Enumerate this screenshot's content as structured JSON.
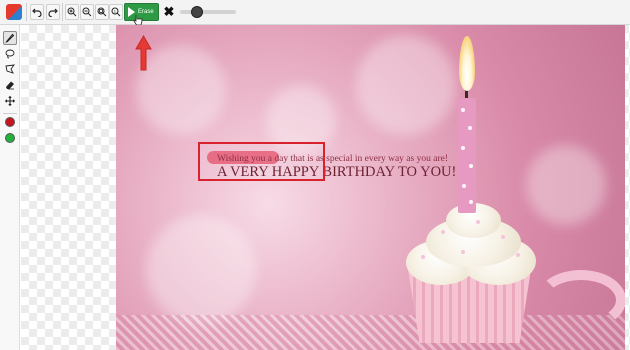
{
  "toolbar": {
    "undo_icon": "undo-icon",
    "redo_icon": "redo-icon",
    "zoom_in_icon": "zoom-in-icon",
    "zoom_out_icon": "zoom-out-icon",
    "zoom_fit_icon": "zoom-fit-icon",
    "zoom_reset_icon": "zoom-reset-icon",
    "erase_label": "Erase",
    "close_icon": "close-icon",
    "brush_size_level": 0.25
  },
  "tools": [
    {
      "name": "brush-tool",
      "icon": "pencil-icon",
      "active": true
    },
    {
      "name": "lasso-tool",
      "icon": "lasso-icon",
      "active": false
    },
    {
      "name": "polygon-lasso-tool",
      "icon": "polygon-lasso-icon",
      "active": false
    },
    {
      "name": "eraser-tool",
      "icon": "eraser-icon",
      "active": false
    },
    {
      "name": "move-tool",
      "icon": "move-icon",
      "active": false
    }
  ],
  "colors": {
    "mark_color": "#c8141e",
    "keep_color": "#22b33a",
    "erase_button": "#2e9a44",
    "selection": "#d8222d"
  },
  "image": {
    "line1": "Wishing you a day that is as special in every way as you are!",
    "line2": "A VERY HAPPY BIRTHDAY TO YOU!"
  }
}
